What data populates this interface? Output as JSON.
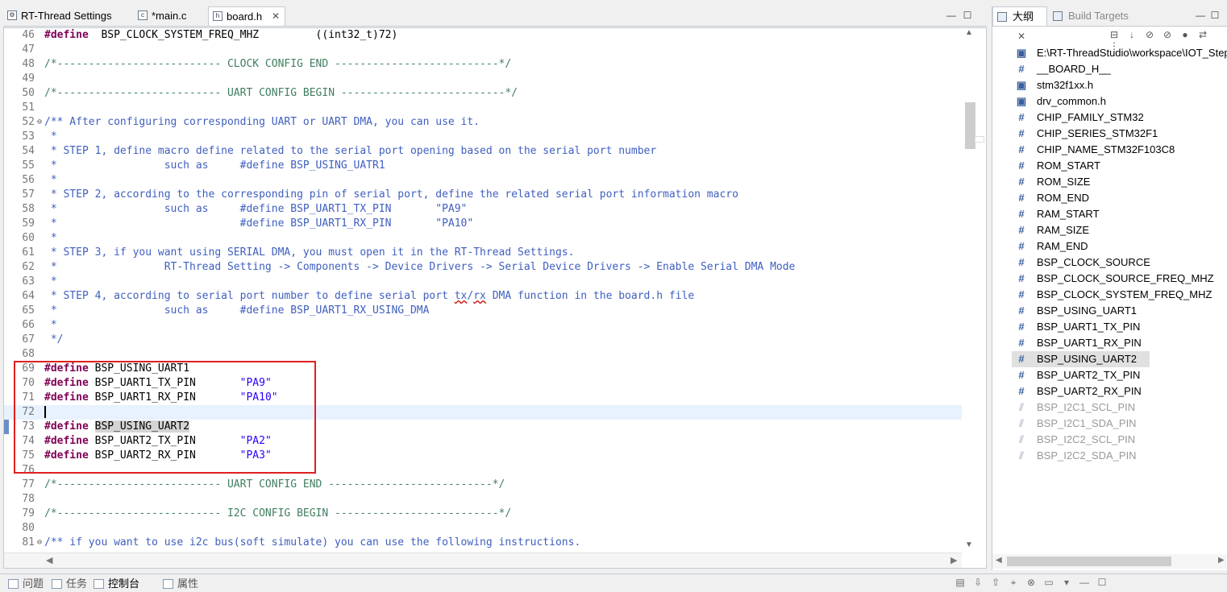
{
  "editor_tabs": [
    {
      "label": "RT-Thread Settings",
      "icon": "settings-file-icon",
      "active": false
    },
    {
      "label": "*main.c",
      "icon": "c-file-icon",
      "active": false
    },
    {
      "label": "board.h",
      "icon": "h-file-icon",
      "active": true
    }
  ],
  "editor_window_buttons": {
    "minimize": "—",
    "maximize": "☐"
  },
  "code_lines": [
    {
      "n": "46",
      "t": [
        [
          "kw",
          "#define"
        ],
        [
          "",
          "  BSP_CLOCK_SYSTEM_FREQ_MHZ         ((int32_t)72)"
        ]
      ]
    },
    {
      "n": "47",
      "t": []
    },
    {
      "n": "48",
      "t": [
        [
          "cmg",
          "/*-------------------------- CLOCK CONFIG END --------------------------*/"
        ]
      ]
    },
    {
      "n": "49",
      "t": []
    },
    {
      "n": "50",
      "t": [
        [
          "cmg",
          "/*-------------------------- UART CONFIG BEGIN --------------------------*/"
        ]
      ]
    },
    {
      "n": "51",
      "t": []
    },
    {
      "n": "52",
      "fold": "⊖",
      "t": [
        [
          "cm",
          "/** After configuring corresponding UART or UART DMA, you can use it."
        ]
      ]
    },
    {
      "n": "53",
      "t": [
        [
          "cm",
          " *"
        ]
      ]
    },
    {
      "n": "54",
      "t": [
        [
          "cm",
          " * STEP 1, define macro define related to the serial port opening based on the serial port number"
        ]
      ]
    },
    {
      "n": "55",
      "t": [
        [
          "cm",
          " *                 such as     #define BSP_USING_UATR1"
        ]
      ]
    },
    {
      "n": "56",
      "t": [
        [
          "cm",
          " *"
        ]
      ]
    },
    {
      "n": "57",
      "t": [
        [
          "cm",
          " * STEP 2, according to the corresponding pin of serial port, define the related serial port information macro"
        ]
      ]
    },
    {
      "n": "58",
      "t": [
        [
          "cm",
          " *                 such as     #define BSP_UART1_TX_PIN       \"PA9\""
        ]
      ]
    },
    {
      "n": "59",
      "t": [
        [
          "cm",
          " *                             #define BSP_UART1_RX_PIN       \"PA10\""
        ]
      ]
    },
    {
      "n": "60",
      "t": [
        [
          "cm",
          " *"
        ]
      ]
    },
    {
      "n": "61",
      "t": [
        [
          "cm",
          " * STEP 3, if you want using SERIAL DMA, you must open it in the RT-Thread Settings."
        ]
      ]
    },
    {
      "n": "62",
      "t": [
        [
          "cm",
          " *                 RT-Thread Setting -> Components -> Device Drivers -> Serial Device Drivers -> Enable Serial DMA Mode"
        ]
      ]
    },
    {
      "n": "63",
      "t": [
        [
          "cm",
          " *"
        ]
      ]
    },
    {
      "n": "64",
      "t": [
        [
          "cm",
          " * STEP 4, according to serial port number to define serial port "
        ],
        [
          "cm sq",
          "tx"
        ],
        [
          "cm",
          "/"
        ],
        [
          "cm sq",
          "rx"
        ],
        [
          "cm",
          " DMA function in the board.h file"
        ]
      ]
    },
    {
      "n": "65",
      "t": [
        [
          "cm",
          " *                 such as     #define BSP_UART1_RX_USING_DMA"
        ]
      ]
    },
    {
      "n": "66",
      "t": [
        [
          "cm",
          " *"
        ]
      ]
    },
    {
      "n": "67",
      "t": [
        [
          "cm",
          " */"
        ]
      ]
    },
    {
      "n": "68",
      "t": []
    },
    {
      "n": "69",
      "t": [
        [
          "kw",
          "#define"
        ],
        [
          "",
          " BSP_USING_UART1"
        ]
      ]
    },
    {
      "n": "70",
      "t": [
        [
          "kw",
          "#define"
        ],
        [
          "",
          " BSP_UART1_TX_PIN       "
        ],
        [
          "str",
          "\"PA9\""
        ]
      ]
    },
    {
      "n": "71",
      "t": [
        [
          "kw",
          "#define"
        ],
        [
          "",
          " BSP_UART1_RX_PIN       "
        ],
        [
          "str",
          "\"PA10\""
        ]
      ]
    },
    {
      "n": "72",
      "current": true,
      "caret": true,
      "t": []
    },
    {
      "n": "73",
      "t": [
        [
          "kw",
          "#define"
        ],
        [
          "",
          " "
        ],
        [
          "hl",
          "BSP_USING_UART2"
        ]
      ]
    },
    {
      "n": "74",
      "t": [
        [
          "kw",
          "#define"
        ],
        [
          "",
          " BSP_UART2_TX_PIN       "
        ],
        [
          "str",
          "\"PA2\""
        ]
      ]
    },
    {
      "n": "75",
      "t": [
        [
          "kw",
          "#define"
        ],
        [
          "",
          " BSP_UART2_RX_PIN       "
        ],
        [
          "str",
          "\"PA3\""
        ]
      ]
    },
    {
      "n": "76",
      "t": []
    },
    {
      "n": "77",
      "t": [
        [
          "cmg",
          "/*-------------------------- UART CONFIG END --------------------------*/"
        ]
      ]
    },
    {
      "n": "78",
      "t": []
    },
    {
      "n": "79",
      "t": [
        [
          "cmg",
          "/*-------------------------- I2C CONFIG BEGIN --------------------------*/"
        ]
      ]
    },
    {
      "n": "80",
      "t": []
    },
    {
      "n": "81",
      "fold": "⊖",
      "t": [
        [
          "cm",
          "/** if you want to use i2c bus(soft simulate) you can use the following instructions."
        ]
      ]
    }
  ],
  "right_tabs": [
    {
      "label": "大纲",
      "active": true
    },
    {
      "label": "Build Targets",
      "active": false
    }
  ],
  "right_window_buttons": {
    "minimize": "—",
    "maximize": "☐"
  },
  "outline_toolbar_icons": [
    "collapse-all-icon",
    "sort-icon",
    "hide-fields-icon",
    "hide-static-icon",
    "hide-non-public-icon",
    "link-editor-icon",
    "menu-icon"
  ],
  "outline_items": [
    {
      "label": "E:\\RT-ThreadStudio\\workspace\\IOT_Step",
      "icon": "include-icon",
      "kind": "inc"
    },
    {
      "label": "__BOARD_H__",
      "icon": "macro-icon",
      "kind": "def"
    },
    {
      "label": "stm32f1xx.h",
      "icon": "include-icon",
      "kind": "inc"
    },
    {
      "label": "drv_common.h",
      "icon": "include-icon",
      "kind": "inc"
    },
    {
      "label": "CHIP_FAMILY_STM32",
      "icon": "macro-icon",
      "kind": "def"
    },
    {
      "label": "CHIP_SERIES_STM32F1",
      "icon": "macro-icon",
      "kind": "def"
    },
    {
      "label": "CHIP_NAME_STM32F103C8",
      "icon": "macro-icon",
      "kind": "def"
    },
    {
      "label": "ROM_START",
      "icon": "macro-icon",
      "kind": "def"
    },
    {
      "label": "ROM_SIZE",
      "icon": "macro-icon",
      "kind": "def"
    },
    {
      "label": "ROM_END",
      "icon": "macro-icon",
      "kind": "def"
    },
    {
      "label": "RAM_START",
      "icon": "macro-icon",
      "kind": "def"
    },
    {
      "label": "RAM_SIZE",
      "icon": "macro-icon",
      "kind": "def"
    },
    {
      "label": "RAM_END",
      "icon": "macro-icon",
      "kind": "def"
    },
    {
      "label": "BSP_CLOCK_SOURCE",
      "icon": "macro-icon",
      "kind": "def"
    },
    {
      "label": "BSP_CLOCK_SOURCE_FREQ_MHZ",
      "icon": "macro-icon",
      "kind": "def"
    },
    {
      "label": "BSP_CLOCK_SYSTEM_FREQ_MHZ",
      "icon": "macro-icon",
      "kind": "def"
    },
    {
      "label": "BSP_USING_UART1",
      "icon": "macro-icon",
      "kind": "def"
    },
    {
      "label": "BSP_UART1_TX_PIN",
      "icon": "macro-icon",
      "kind": "def"
    },
    {
      "label": "BSP_UART1_RX_PIN",
      "icon": "macro-icon",
      "kind": "def"
    },
    {
      "label": "BSP_USING_UART2",
      "icon": "macro-icon",
      "kind": "def",
      "selected": true
    },
    {
      "label": "BSP_UART2_TX_PIN",
      "icon": "macro-icon",
      "kind": "def"
    },
    {
      "label": "BSP_UART2_RX_PIN",
      "icon": "macro-icon",
      "kind": "def"
    },
    {
      "label": "BSP_I2C1_SCL_PIN",
      "icon": "inactive-macro-icon",
      "kind": "dim"
    },
    {
      "label": "BSP_I2C1_SDA_PIN",
      "icon": "inactive-macro-icon",
      "kind": "dim"
    },
    {
      "label": "BSP_I2C2_SCL_PIN",
      "icon": "inactive-macro-icon",
      "kind": "dim"
    },
    {
      "label": "BSP_I2C2_SDA_PIN",
      "icon": "inactive-macro-icon",
      "kind": "dim"
    }
  ],
  "bottom_tabs": [
    {
      "label": "问题",
      "active": false
    },
    {
      "label": "任务",
      "active": false
    },
    {
      "label": "控制台",
      "active": true
    },
    {
      "label": "属性",
      "active": false
    }
  ],
  "bottom_tool_icons": [
    "console-icon",
    "scroll-down-icon",
    "scroll-up-icon",
    "pin-icon",
    "clear-icon",
    "display-icon",
    "open-console-icon",
    "minimize-icon",
    "maximize-icon"
  ],
  "colors": {
    "keyword": "#7f0055",
    "comment": "#3f5fbf",
    "string": "#2a00ff",
    "highlight_box": "#e02020"
  }
}
